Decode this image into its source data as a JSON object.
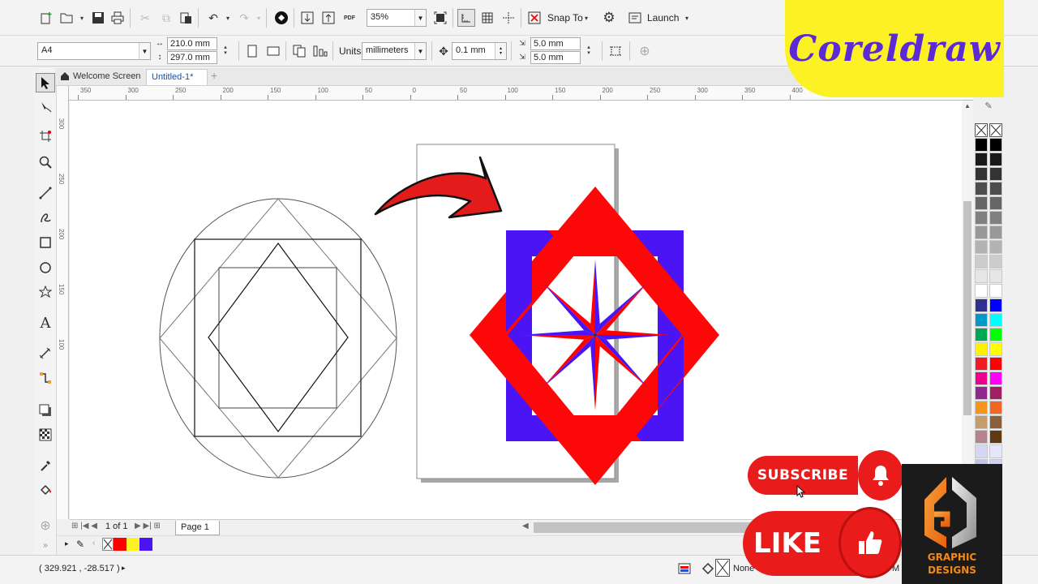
{
  "toolbar": {
    "zoom": "35%",
    "snap_to": "Snap To",
    "launch": "Launch",
    "pdf_label": "PDF"
  },
  "property_bar": {
    "page_size": "A4",
    "width": "210.0 mm",
    "height": "297.0 mm",
    "units_label": "Units:",
    "units_value": "millimeters",
    "nudge": "0.1 mm",
    "dup_x": "5.0 mm",
    "dup_y": "5.0 mm"
  },
  "tabs": {
    "welcome": "Welcome Screen",
    "doc": "Untitled-1*",
    "add": "+"
  },
  "ruler": {
    "h_ticks": [
      "350",
      "300",
      "250",
      "200",
      "150",
      "100",
      "50",
      "0",
      "50",
      "100",
      "150",
      "200",
      "250",
      "300",
      "350",
      "400"
    ],
    "v_ticks": [
      "300",
      "250",
      "200",
      "150",
      "100"
    ]
  },
  "page_nav": {
    "page_count": "1 of 1",
    "page_tab": "Page 1"
  },
  "status": {
    "coords": "( 329.921 , -28.517 )",
    "fill_none": "None",
    "outline_letter": "M"
  },
  "overlay": {
    "brand": "Coreldraw",
    "subscribe": "SUBSCRIBE",
    "like": "LIKE",
    "gd_line1": "GRAPHIC",
    "gd_line2": "DESIGNS"
  },
  "colors": {
    "red": "#ff0000",
    "blue": "#4a14f5",
    "yellow": "#fcf124",
    "purple": "#5b2ad6"
  },
  "icons": [
    "new-document-icon",
    "open-icon",
    "save-icon",
    "print-icon",
    "undo-icon",
    "redo-icon",
    "import-icon",
    "export-icon",
    "zoom-fit-icon",
    "options-icon",
    "pick-tool-icon",
    "shape-tool-icon",
    "crop-tool-icon",
    "zoom-tool-icon",
    "freehand-tool-icon",
    "artistic-media-icon",
    "rectangle-tool-icon",
    "ellipse-tool-icon",
    "polygon-tool-icon",
    "text-tool-icon",
    "connector-tool-icon",
    "blend-tool-icon",
    "shadow-tool-icon",
    "transparency-tool-icon",
    "eyedropper-icon",
    "fill-icon",
    "bell-icon",
    "thumbs-up-icon"
  ]
}
